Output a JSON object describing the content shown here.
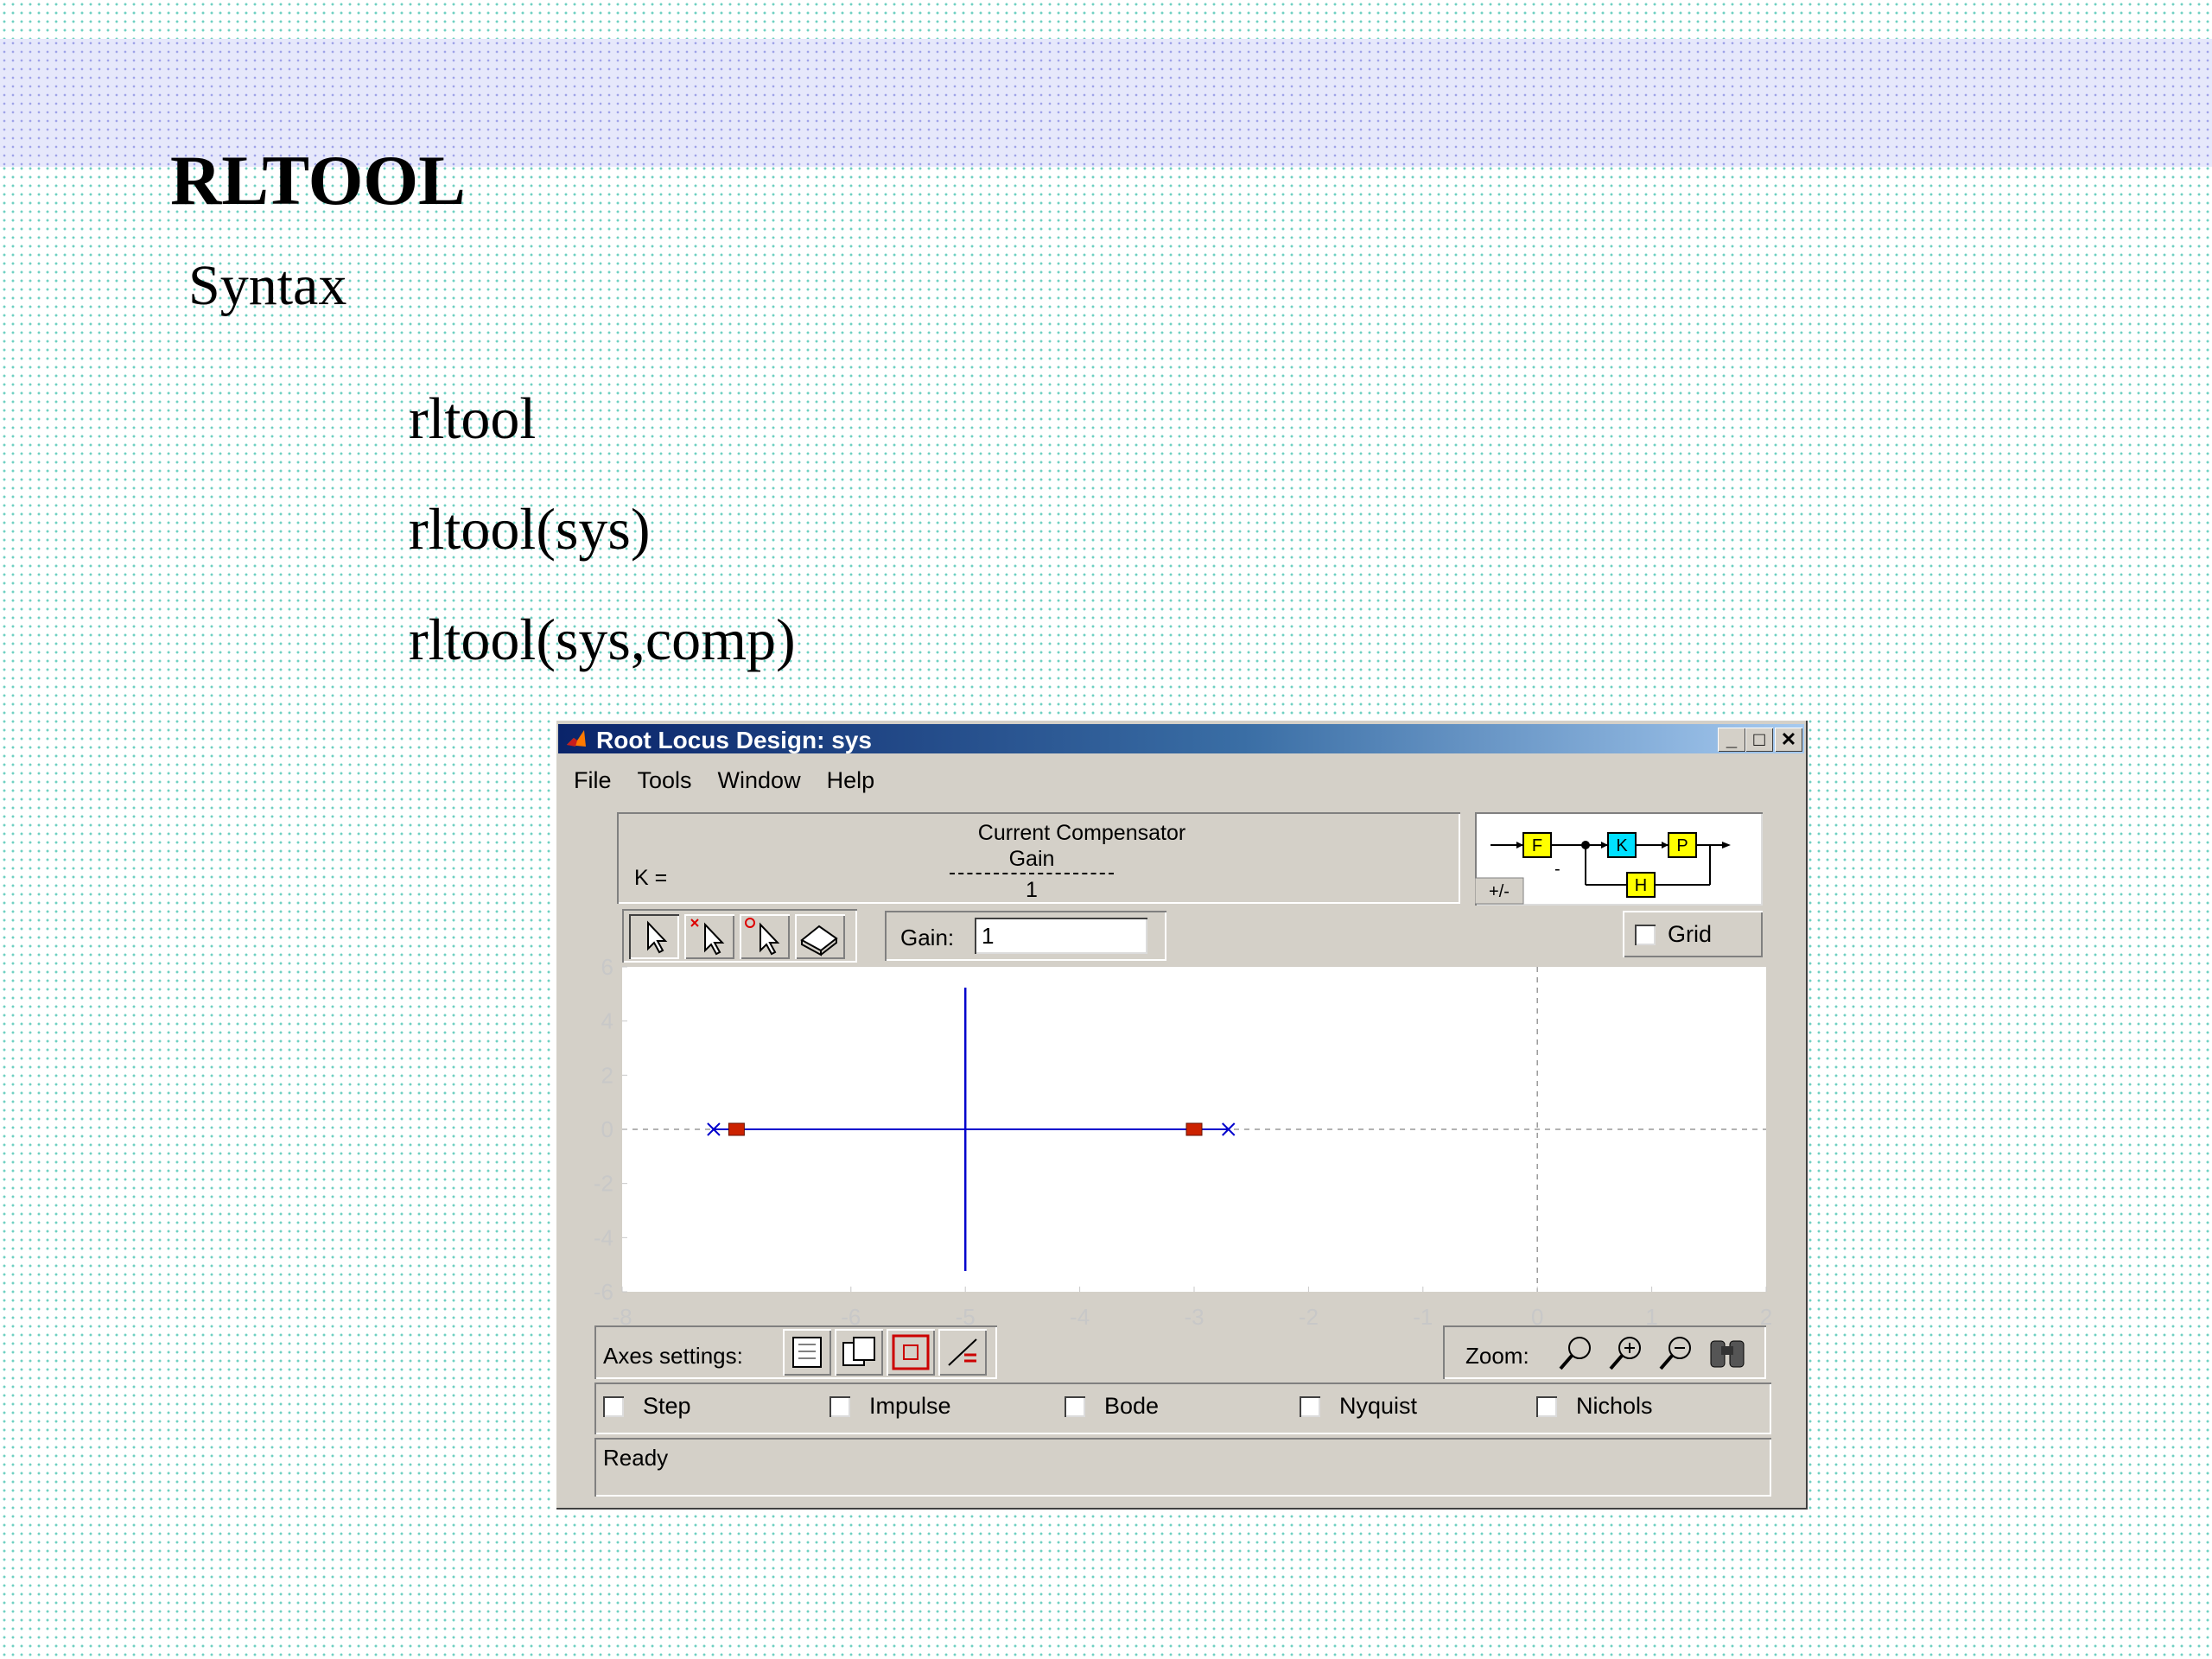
{
  "slide": {
    "title": "RLTOOL",
    "subheading": "Syntax",
    "commands": [
      "rltool",
      "rltool(sys)",
      "rltool(sys,comp)"
    ]
  },
  "window": {
    "title": "Root Locus Design: sys",
    "controls": {
      "minimize": "_",
      "maximize": "□",
      "close": "✕"
    },
    "menu": [
      "File",
      "Tools",
      "Window",
      "Help"
    ],
    "compensator": {
      "title": "Current Compensator",
      "k_label": "K =",
      "numerator": "Gain",
      "denominator": "1"
    },
    "diagram": {
      "blocks": [
        "F",
        "K",
        "P",
        "H"
      ],
      "sign_toggle": "+/-",
      "feedback_sign": "-"
    },
    "toolbar": {
      "tools": [
        "select-icon",
        "add-pole-icon",
        "add-zero-icon",
        "eraser-icon"
      ]
    },
    "gain": {
      "label": "Gain:",
      "value": "1"
    },
    "grid": {
      "label": "Grid",
      "checked": false
    },
    "plot": {
      "x_ticks": [
        "-8",
        "-6",
        "-5",
        "-4",
        "-3",
        "-2",
        "-1",
        "0",
        "1",
        "2"
      ],
      "y_ticks": [
        "6",
        "4",
        "2",
        "0",
        "-2",
        "-4",
        "-6"
      ],
      "x_range": [
        -8,
        2
      ],
      "y_range": [
        -6,
        6
      ],
      "open_loop_poles": [
        [
          -7.2,
          0
        ],
        [
          -2.7,
          0
        ]
      ],
      "closed_loop_poles": [
        [
          -7.0,
          0
        ],
        [
          -3.0,
          0
        ]
      ],
      "breakaway_x": -5,
      "colors": {
        "locus": "#0000cc",
        "closed_loop": "#cc2200",
        "grid": "#999999"
      }
    },
    "axes_settings": {
      "label": "Axes settings:",
      "buttons": [
        "axes-limits-icon",
        "axes-fit-icon",
        "axes-square-icon",
        "axes-equal-icon"
      ]
    },
    "zoom": {
      "label": "Zoom:",
      "buttons": [
        "zoom-x-icon",
        "zoom-y-icon",
        "zoom-xy-icon",
        "zoom-out-icon"
      ]
    },
    "responses": [
      {
        "label": "Step",
        "checked": false
      },
      {
        "label": "Impulse",
        "checked": false
      },
      {
        "label": "Bode",
        "checked": false
      },
      {
        "label": "Nyquist",
        "checked": false
      },
      {
        "label": "Nichols",
        "checked": false
      }
    ],
    "status": "Ready"
  }
}
